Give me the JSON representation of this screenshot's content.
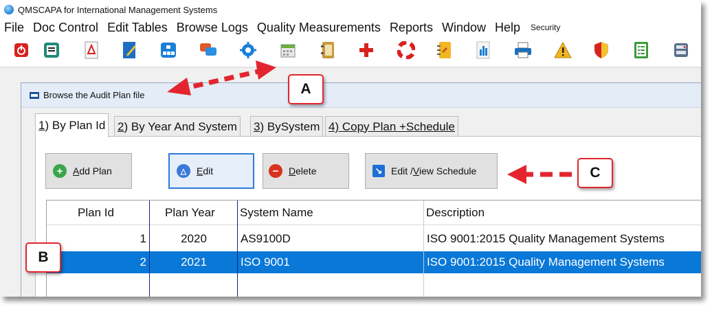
{
  "window": {
    "title": "QMSCAPA for International Management Systems"
  },
  "menu": [
    {
      "label": "File"
    },
    {
      "label": "Doc Control"
    },
    {
      "label": "Edit Tables"
    },
    {
      "label": "Browse Logs"
    },
    {
      "label": "Quality Measurements"
    },
    {
      "label": "Reports"
    },
    {
      "label": "Window"
    },
    {
      "label": "Help"
    },
    {
      "label": "Security"
    }
  ],
  "toolbar": {
    "icons": [
      "power-icon",
      "document-icon",
      "pdf-icon",
      "pen-icon",
      "org-chart-icon",
      "chat-icon",
      "gear-icon",
      "calendar-icon",
      "address-book-icon",
      "plus-icon",
      "lifebuoy-icon",
      "notes-icon",
      "bar-chart-icon",
      "printer-icon",
      "warning-icon",
      "shield-icon",
      "checklist-icon",
      "server-icon"
    ]
  },
  "inner_window": {
    "title": "Browse the Audit Plan file",
    "tabs": [
      {
        "prefix": "1",
        "label": ") By Plan Id"
      },
      {
        "prefix": "2",
        "label": ") By Year And System"
      },
      {
        "prefix": "3",
        "label": ") BySystem"
      },
      {
        "label": "4) Copy Plan +Schedule"
      }
    ],
    "buttons": {
      "add": {
        "mnemonic": "A",
        "rest": "dd Plan"
      },
      "edit": {
        "mnemonic": "E",
        "rest": "dit"
      },
      "delete": {
        "mnemonic": "D",
        "rest": "elete"
      },
      "schedule": {
        "before": "Edit /",
        "mnemonic": "V",
        "rest": "iew Schedule"
      }
    },
    "grid": {
      "columns": [
        "Plan Id",
        "Plan Year",
        "System Name",
        "Description"
      ],
      "rows": [
        {
          "plan_id": "1",
          "plan_year": "2020",
          "system_name": "AS9100D",
          "description": "ISO 9001:2015 Quality Management Systems"
        },
        {
          "plan_id": "2",
          "plan_year": "2021",
          "system_name": "ISO 9001",
          "description": "ISO 9001:2015 Quality Management Systems"
        }
      ]
    }
  },
  "annotations": {
    "a": "A",
    "b": "B",
    "c": "C"
  },
  "colors": {
    "selection": "#0a78d7",
    "callout_border": "#e2252e",
    "arrow": "#e2252e"
  }
}
